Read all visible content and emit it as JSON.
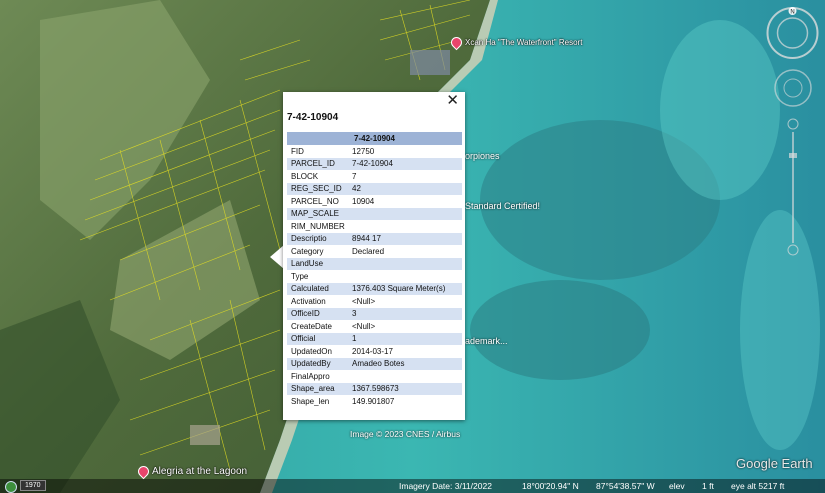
{
  "map": {
    "placemarks": [
      {
        "label": "Xcan Ha \"The Waterfront\" Resort"
      },
      {
        "label": "Alegria at the Lagoon"
      }
    ],
    "partial_labels": [
      "orpiones",
      "Standard Certified!",
      "ademark..."
    ],
    "imagery_credit": "Image © 2023 CNES / Airbus",
    "logo": "Google Earth"
  },
  "popup": {
    "title": "7-42-10904",
    "table_header": "7-42-10904",
    "rows": [
      {
        "key": "FID",
        "value": "12750"
      },
      {
        "key": "PARCEL_ID",
        "value": "7-42-10904"
      },
      {
        "key": "BLOCK",
        "value": "7"
      },
      {
        "key": "REG_SEC_ID",
        "value": "42"
      },
      {
        "key": "PARCEL_NO",
        "value": "10904"
      },
      {
        "key": "MAP_SCALE",
        "value": ""
      },
      {
        "key": "RIM_NUMBER",
        "value": ""
      },
      {
        "key": "Descriptio",
        "value": "8944 17"
      },
      {
        "key": "Category",
        "value": "Declared"
      },
      {
        "key": "LandUse",
        "value": ""
      },
      {
        "key": "Type",
        "value": ""
      },
      {
        "key": "Calculated",
        "value": "1376.403 Square Meter(s)"
      },
      {
        "key": "Activation",
        "value": "<Null>"
      },
      {
        "key": "OfficeID",
        "value": "3"
      },
      {
        "key": "CreateDate",
        "value": "<Null>"
      },
      {
        "key": "Official",
        "value": "1"
      },
      {
        "key": "UpdatedOn",
        "value": "2014-03-17"
      },
      {
        "key": "UpdatedBy",
        "value": "Amadeo Botes"
      },
      {
        "key": "FinalAppro",
        "value": ""
      },
      {
        "key": "Shape_area",
        "value": "1367.598673"
      },
      {
        "key": "Shape_len",
        "value": "149.901807"
      }
    ],
    "close_label": "✕"
  },
  "controls": {
    "compass_north": "N"
  },
  "status": {
    "year": "1970",
    "imagery_date": "Imagery Date: 3/11/2022",
    "lat": "18°00'20.94\" N",
    "lon": "87°54'38.57\" W",
    "elev_label": "elev",
    "elev_value": "1 ft",
    "eye_alt": "eye alt  5217 ft"
  }
}
